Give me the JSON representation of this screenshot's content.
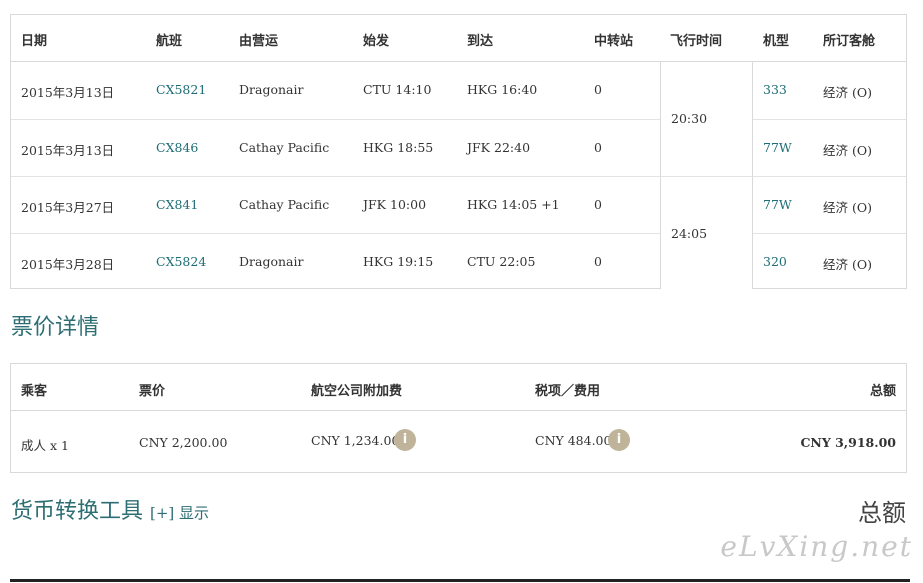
{
  "flight_table": {
    "headers": {
      "date": "日期",
      "flight": "航班",
      "operator": "由营运",
      "depart": "始发",
      "arrive": "到达",
      "stops": "中转站",
      "duration": "飞行时间",
      "aircraft": "机型",
      "cabin": "所订客舱"
    },
    "rows": [
      {
        "date": "2015年3月13日",
        "flight": "CX5821",
        "operator": "Dragonair",
        "depart": "CTU 14:10",
        "arrive": "HKG 16:40",
        "stops": "0",
        "aircraft": "333",
        "cabin": "经济 (O)"
      },
      {
        "date": "2015年3月13日",
        "flight": "CX846",
        "operator": "Cathay Pacific",
        "depart": "HKG 18:55",
        "arrive": "JFK 22:40",
        "stops": "0",
        "aircraft": "77W",
        "cabin": "经济 (O)"
      },
      {
        "date": "2015年3月27日",
        "flight": "CX841",
        "operator": "Cathay Pacific",
        "depart": "JFK 10:00",
        "arrive": "HKG 14:05 +1",
        "stops": "0",
        "aircraft": "77W",
        "cabin": "经济 (O)"
      },
      {
        "date": "2015年3月28日",
        "flight": "CX5824",
        "operator": "Dragonair",
        "depart": "HKG 19:15",
        "arrive": "CTU 22:05",
        "stops": "0",
        "aircraft": "320",
        "cabin": "经济 (O)"
      }
    ],
    "durations": [
      "20:30",
      "24:05"
    ]
  },
  "fare_section": {
    "title": "票价详情",
    "headers": {
      "passenger": "乘客",
      "fare": "票价",
      "surcharge": "航空公司附加费",
      "taxes": "税项／费用",
      "total": "总额"
    },
    "row": {
      "passenger": "成人 x 1",
      "fare": "CNY 2,200.00",
      "surcharge": "CNY 1,234.00",
      "taxes": "CNY 484.00",
      "total": "CNY 3,918.00"
    },
    "info_icon": "i"
  },
  "converter": {
    "title": "货币转换工具",
    "toggle": "[+] 显示"
  },
  "total_heading": "总额",
  "watermark": "eLvXing.net",
  "colors": {
    "link": "#1f6e76",
    "section_title": "#2c6e73",
    "info_icon_bg": "#bfb49a",
    "border": "#d9d9d9"
  }
}
